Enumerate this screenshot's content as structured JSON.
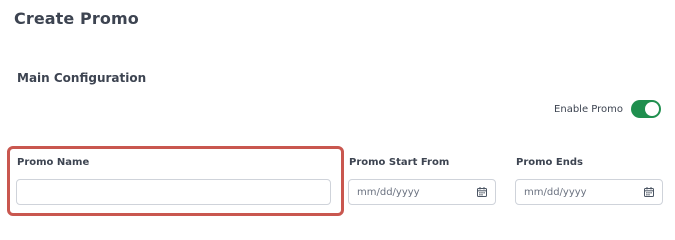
{
  "page": {
    "title": "Create Promo",
    "section_title": "Main Configuration"
  },
  "enable_promo": {
    "label": "Enable Promo",
    "enabled": true,
    "color": "#1f8f4e"
  },
  "highlight_color": "#c9574f",
  "fields": {
    "promo_name": {
      "label": "Promo Name",
      "value": "",
      "placeholder": ""
    },
    "promo_start": {
      "label": "Promo Start From",
      "placeholder": "mm/dd/yyyy",
      "icon": "calendar-icon"
    },
    "promo_ends": {
      "label": "Promo Ends",
      "placeholder": "mm/dd/yyyy",
      "icon": "calendar-icon"
    }
  }
}
